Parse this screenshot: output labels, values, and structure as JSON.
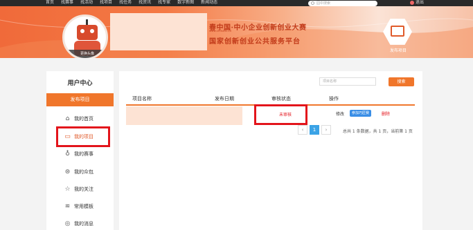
{
  "topnav": {
    "links": [
      "首页",
      "找赛事",
      "找活动",
      "找项目",
      "找任务",
      "找资讯",
      "找专家",
      "数字新图",
      "新闻动态"
    ],
    "search_placeholder": "园中搜索",
    "logout": "退出"
  },
  "banner": {
    "avatar_change": "更换头像",
    "slogan_line1": "春中国·中小企业创新创业大赛",
    "slogan_small": "www.chinahc.cn",
    "slogan_line2": "国家创新创业公共服务平台",
    "publish_label": "发布项目"
  },
  "sidebar": {
    "title": "用户中心",
    "publish_button": "发布项目",
    "items": [
      {
        "label": "我的首页",
        "icon": "home-icon"
      },
      {
        "label": "我的项目",
        "icon": "project-icon"
      },
      {
        "label": "我的赛事",
        "icon": "trophy-icon"
      },
      {
        "label": "我的众包",
        "icon": "crowdsource-icon"
      },
      {
        "label": "我的关注",
        "icon": "star-icon"
      },
      {
        "label": "常用模板",
        "icon": "layers-icon"
      },
      {
        "label": "我的消息",
        "icon": "message-icon"
      }
    ]
  },
  "main": {
    "search_placeholder": "项目名称",
    "search_button": "搜索",
    "columns": [
      "项目名称",
      "发布日期",
      "审核状态",
      "操作"
    ],
    "rows": [
      {
        "status": "未审核",
        "edit": "修改",
        "join": "参加巧匠赛",
        "delete": "删除"
      }
    ],
    "pager": {
      "prev": "‹",
      "page": "1",
      "next": "›",
      "info": "总共 1 条数据，共 1 页，当前第 1 页"
    }
  },
  "colors": {
    "accent": "#f0762b",
    "highlight": "#e3141b",
    "link_blue": "#3a8ee6"
  }
}
